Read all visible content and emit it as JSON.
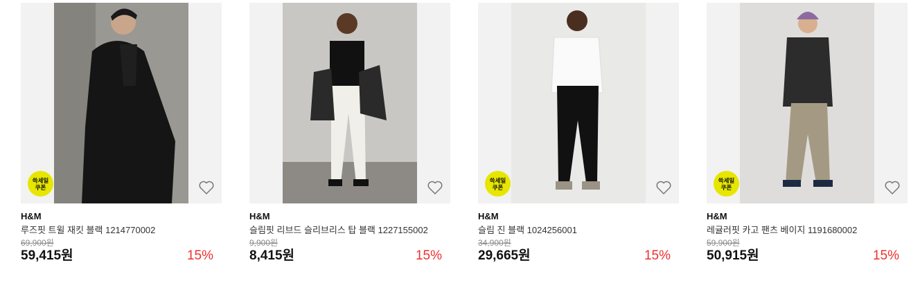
{
  "products": [
    {
      "brand": "H&M",
      "name": "루즈핏 트윌 재킷 블랙 1214770002",
      "original_price": "69,900원",
      "price": "59,415원",
      "discount": "15%",
      "badge": [
        "쓱세일",
        "쿠폰"
      ],
      "has_badge": true,
      "icon": "heart-outline-icon"
    },
    {
      "brand": "H&M",
      "name": "슬림핏 리브드 슬리브리스 탑 블랙 1227155002",
      "original_price": "9,900원",
      "price": "8,415원",
      "discount": "15%",
      "has_badge": false,
      "icon": "heart-outline-icon"
    },
    {
      "brand": "H&M",
      "name": "슬림 진 블랙 1024256001",
      "original_price": "34,900원",
      "price": "29,665원",
      "discount": "15%",
      "badge": [
        "쓱세일",
        "쿠폰"
      ],
      "has_badge": true,
      "icon": "heart-outline-icon"
    },
    {
      "brand": "H&M",
      "name": "레귤러핏 카고 팬츠 베이지 1191680002",
      "original_price": "59,900원",
      "price": "50,915원",
      "discount": "15%",
      "badge": [
        "쓱세일",
        "쿠폰"
      ],
      "has_badge": true,
      "icon": "heart-outline-icon"
    }
  ],
  "colors": {
    "badge": "#e6e600",
    "discount": "#ef2f2f",
    "strike": "#8a8a8a"
  }
}
